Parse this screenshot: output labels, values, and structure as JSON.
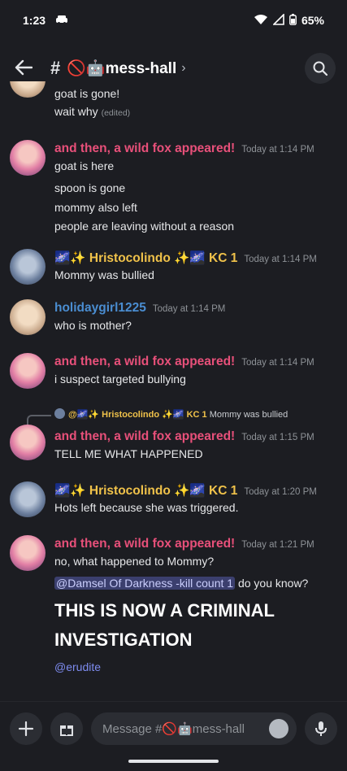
{
  "status": {
    "time": "1:23",
    "battery": "65%"
  },
  "header": {
    "channel": "🚫🤖mess-hall"
  },
  "messages": {
    "top_line1": "goat is gone!",
    "top_line2": "wait why",
    "top_edited": "(edited)",
    "m1": {
      "author": "and then, a wild fox appeared!",
      "time": "Today at 1:14 PM",
      "lines": [
        "goat is here",
        "spoon is gone",
        "mommy also left",
        "people are leaving without a reason"
      ]
    },
    "m2": {
      "author": "🌌✨ Hristocolindo ✨🌌 KC 1",
      "time": "Today at 1:14 PM",
      "lines": [
        "Mommy was bullied"
      ]
    },
    "m3": {
      "author": "holidaygirl1225",
      "time": "Today at 1:14 PM",
      "lines": [
        "who is mother?"
      ]
    },
    "m4": {
      "author": "and then, a wild fox appeared!",
      "time": "Today at 1:14 PM",
      "lines": [
        "i suspect targeted bullying"
      ]
    },
    "m5": {
      "reply_author": "@🌌✨ Hristocolindo ✨🌌 KC 1",
      "reply_text": "Mommy was bullied",
      "author": "and then, a wild fox appeared!",
      "time": "Today at 1:15 PM",
      "lines": [
        "TELL ME WHAT HAPPENED"
      ]
    },
    "m6": {
      "author": "🌌✨ Hristocolindo ✨🌌 KC 1",
      "time": "Today at 1:20 PM",
      "lines": [
        "Hots left because she was triggered."
      ]
    },
    "m7": {
      "author": "and then, a wild fox appeared!",
      "time": "Today at 1:21 PM",
      "line1": "no, what happened to Mommy?",
      "mention": "@Damsel Of Darkness -kill count 1",
      "line2_suffix": " do you know?",
      "big1": "THIS IS NOW A CRIMINAL",
      "big2": "INVESTIGATION",
      "mention2": "@erudite"
    }
  },
  "composer": {
    "placeholder": "Message #🚫🤖mess-hall"
  }
}
